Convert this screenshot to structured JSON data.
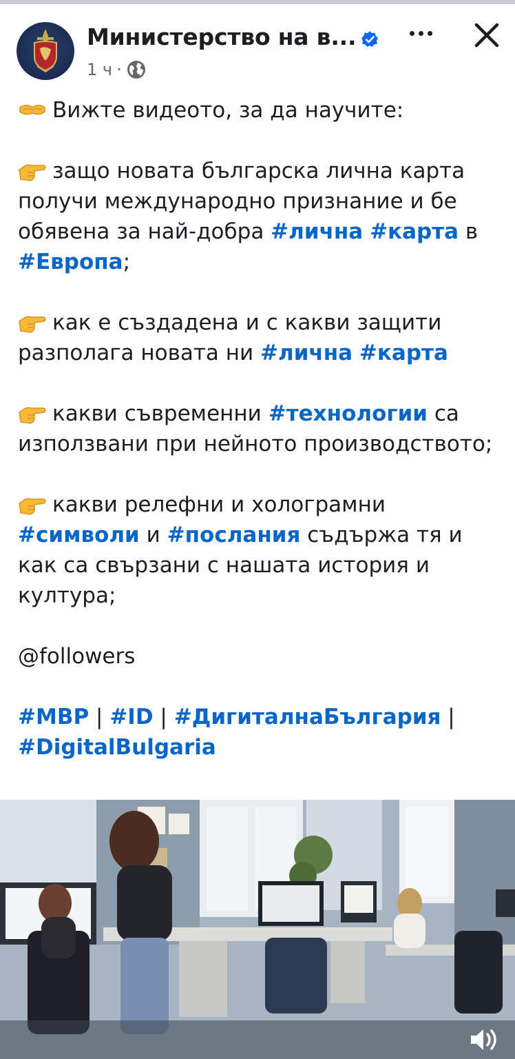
{
  "post": {
    "page_name": "Министерство на в...",
    "time": "1 ч",
    "separator": "·",
    "privacy_icon": "globe-icon",
    "verified_icon": "verified-badge-icon",
    "more_icon": "more-options-icon",
    "close_icon": "close-icon"
  },
  "text": {
    "intro": "Вижте видеото, за да научите:",
    "b1_a": "защо новата българска лична карта получи международно признание и бе обявена за най-добра ",
    "b1_tag1": "#лична",
    "b1_tag2": "#карта",
    "b1_mid": " в ",
    "b1_tag3": "#Европа",
    "b1_end": ";",
    "b2_a": "как е създадена и с какви защити разполага новата ни ",
    "b2_tag1": "#лична",
    "b2_tag2": "#карта",
    "b3_a": "какви съвременни ",
    "b3_tag1": "#технологии",
    "b3_b": " са използвани при нейното производството;",
    "b4_a": "какви релефни и холограмни ",
    "b4_tag1": "#символи",
    "b4_mid": " и ",
    "b4_tag2": "#послания",
    "b4_b": " съдържа тя и как са свързани с нашата история и култура;",
    "mention": "@followers",
    "tag_mvr": "#МВР",
    "tag_id": "#ID",
    "tag_digital_bg": "#ДигиталнаБългария",
    "tag_digital_bulgaria": "#DigitalBulgaria",
    "pipe": " | "
  },
  "icons": {
    "intro_emoji": "pointing-hands-emoji",
    "bullet_emoji": "backhand-index-pointing-right-emoji",
    "sound": "speaker-sound-icon"
  },
  "colors": {
    "hashtag": "#0866c6",
    "verified": "#0866ff",
    "secondary_text": "#65676b"
  }
}
